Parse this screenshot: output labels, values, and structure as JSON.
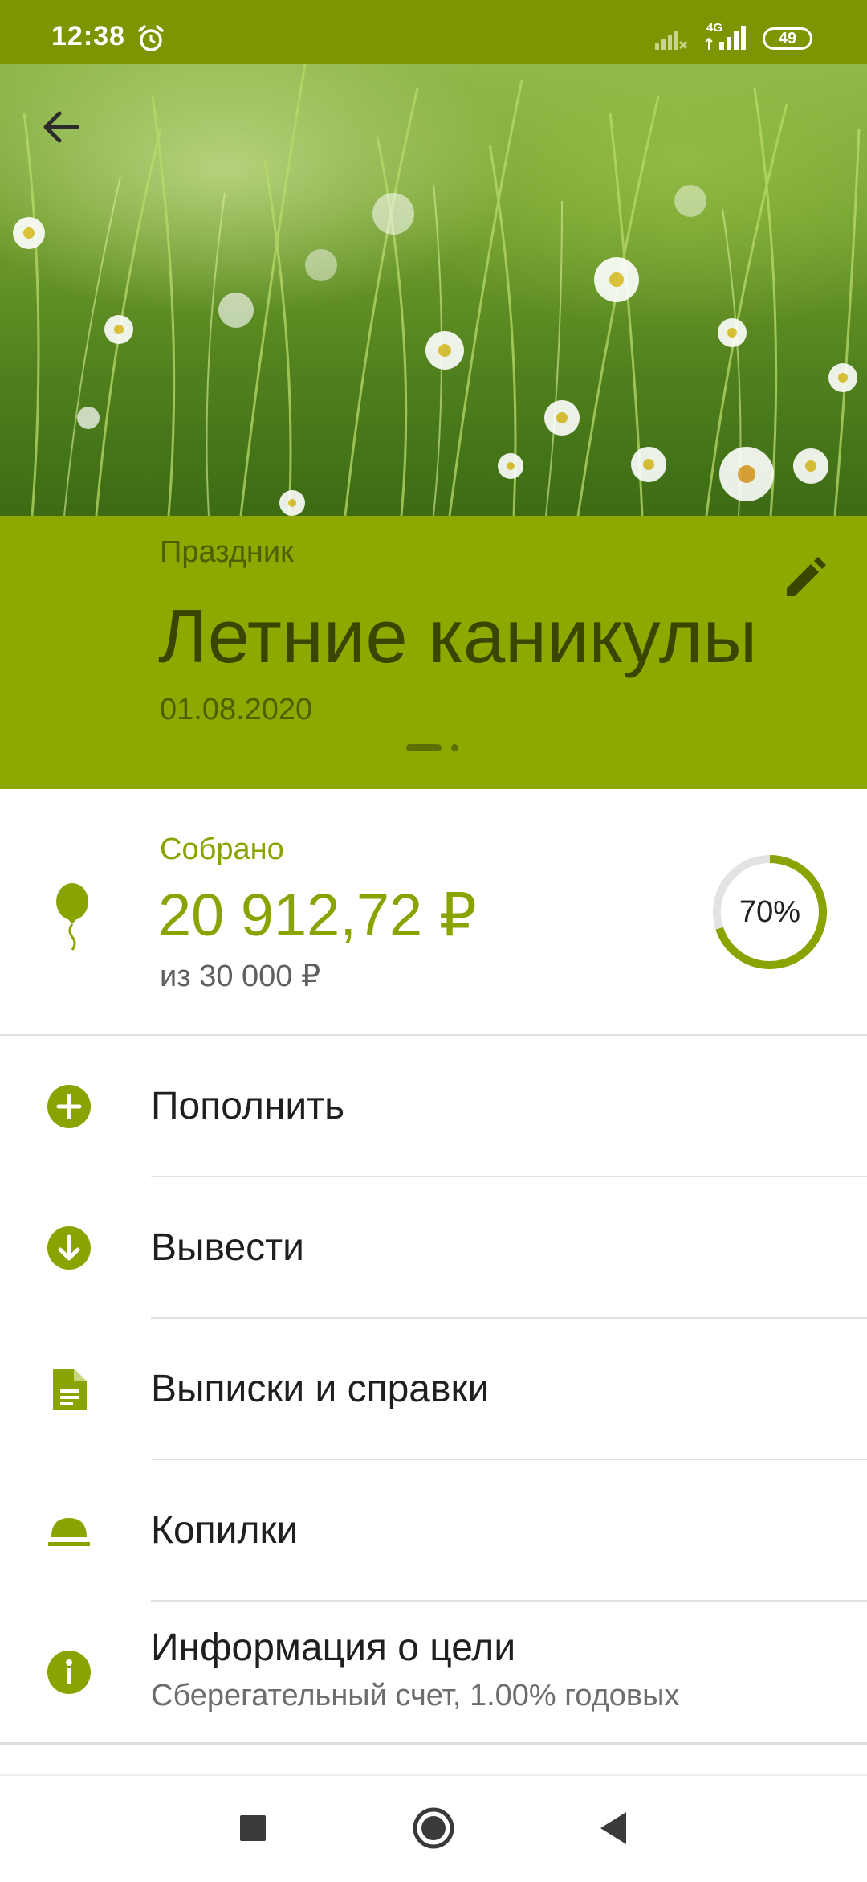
{
  "status_bar": {
    "time": "12:38",
    "network": "4G",
    "battery": "49",
    "icons": [
      "alarm-icon",
      "signal-icon",
      "battery-icon"
    ]
  },
  "hero": {
    "image": "daisy-meadow-photo"
  },
  "goal": {
    "category": "Праздник",
    "title": "Летние каникулы",
    "date": "01.08.2020",
    "pager_count": 2,
    "pager_active": 0
  },
  "summary": {
    "collected_label": "Собрано",
    "collected_amount": "20 912,72 ₽",
    "target_amount": "из 30 000 ₽",
    "progress_percent": 70,
    "progress_text": "70%"
  },
  "menu": {
    "items": [
      {
        "label": "Пополнить",
        "icon": "plus-circle-icon"
      },
      {
        "label": "Вывести",
        "icon": "arrow-down-circle-icon"
      },
      {
        "label": "Выписки и справки",
        "icon": "document-icon"
      },
      {
        "label": "Копилки",
        "icon": "piggy-bank-icon"
      },
      {
        "label": "Информация о цели",
        "sublabel": "Сберегательный счет, 1.00% годовых",
        "icon": "info-icon"
      }
    ]
  },
  "colors": {
    "status_bar": "#7b9600",
    "title_band": "#8ea800",
    "accent": "#8aa300",
    "title_text": "#3b4500",
    "ring_track": "#e3e3e3"
  },
  "nav_bar": {
    "buttons": [
      "recent-apps-icon",
      "home-icon",
      "back-icon"
    ]
  }
}
